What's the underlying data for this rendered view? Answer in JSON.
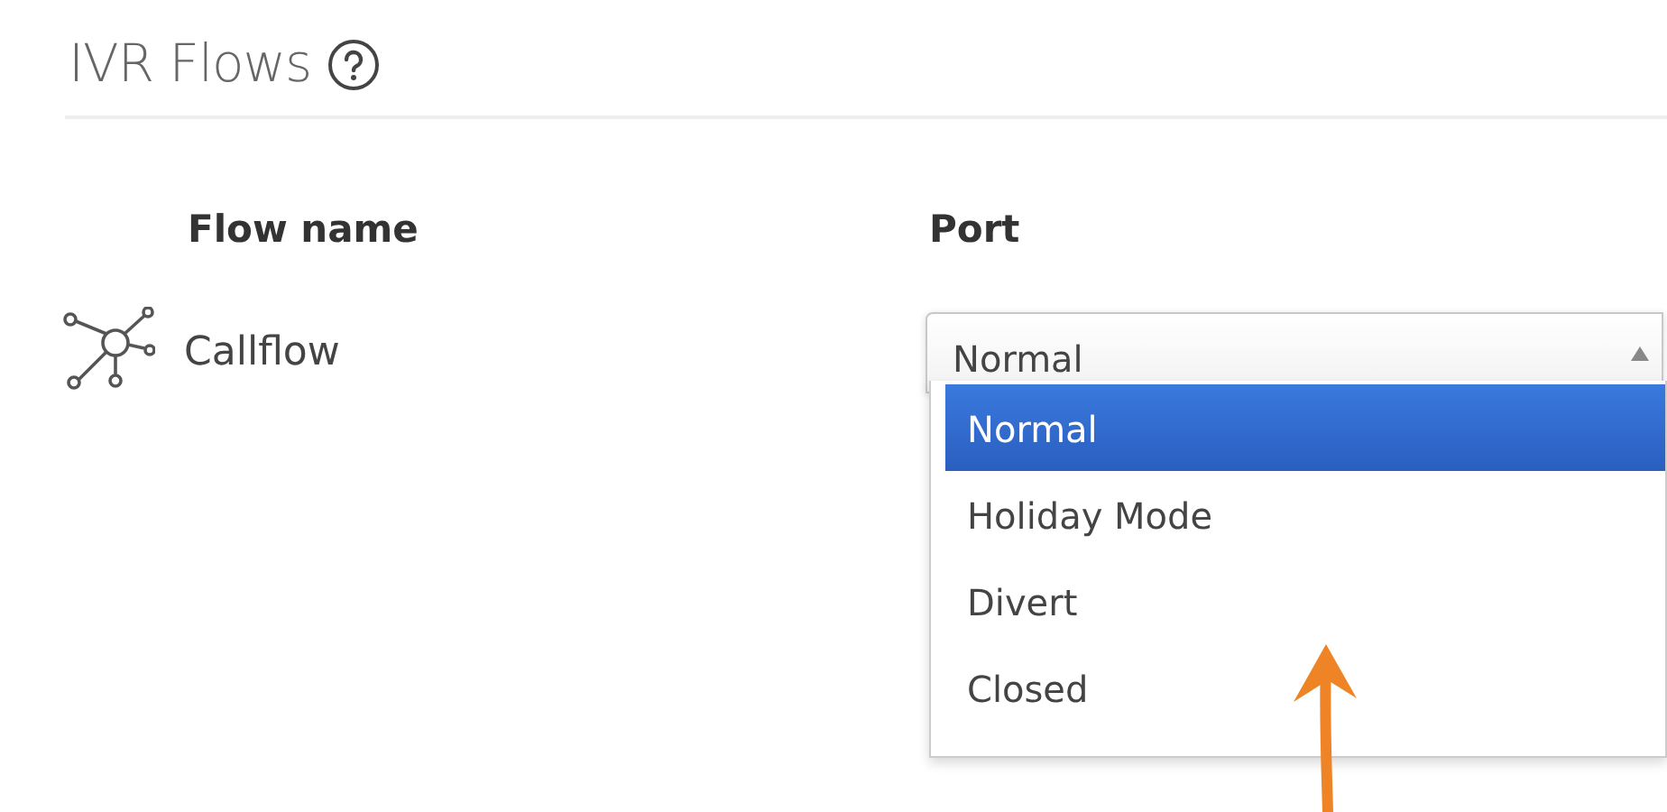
{
  "header": {
    "title": "IVR Flows"
  },
  "table": {
    "columns": [
      "Flow name",
      "Port"
    ],
    "rows": [
      {
        "name": "Callflow",
        "port": {
          "value": "Normal",
          "expanded": true,
          "options": [
            {
              "label": "Normal",
              "selected": true
            },
            {
              "label": "Holiday Mode",
              "selected": false
            },
            {
              "label": "Divert",
              "selected": false
            },
            {
              "label": "Closed",
              "selected": false
            }
          ]
        }
      }
    ]
  }
}
